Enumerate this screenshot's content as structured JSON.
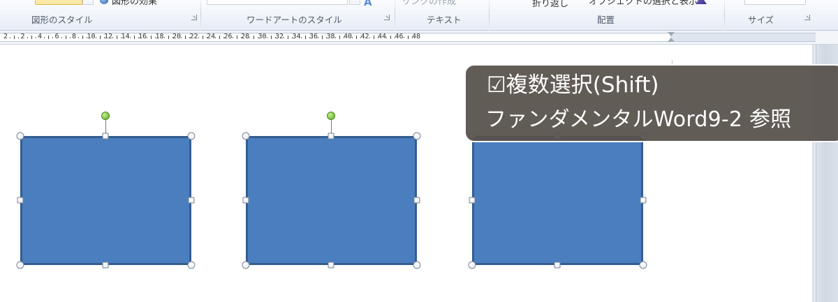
{
  "ribbon": {
    "cut_labels": {
      "shape_effects": "図形の効果",
      "create_link": "リンクの作成",
      "wrap_text": "折り返し",
      "selection_pane": "オブジェクトの選択と表示"
    },
    "groups": [
      {
        "label": "図形のスタイル"
      },
      {
        "label": "ワードアートのスタイル"
      },
      {
        "label": "テキスト"
      },
      {
        "label": "配置"
      },
      {
        "label": "サイズ"
      }
    ]
  },
  "ruler": {
    "numbers": [
      2,
      2,
      4,
      6,
      8,
      10,
      12,
      14,
      16,
      18,
      20,
      22,
      24,
      26,
      28,
      30,
      32,
      34,
      36,
      38,
      40,
      42,
      44,
      46,
      48
    ]
  },
  "callout": {
    "line1": "☑複数選択(Shift)",
    "line2": "ファンダメンタルWord9-2 参照"
  },
  "colors": {
    "shape_fill": "#4a7ebf",
    "shape_border": "#355d8f",
    "rotation_handle": "#58a923",
    "callout_bg": "#58524d"
  }
}
